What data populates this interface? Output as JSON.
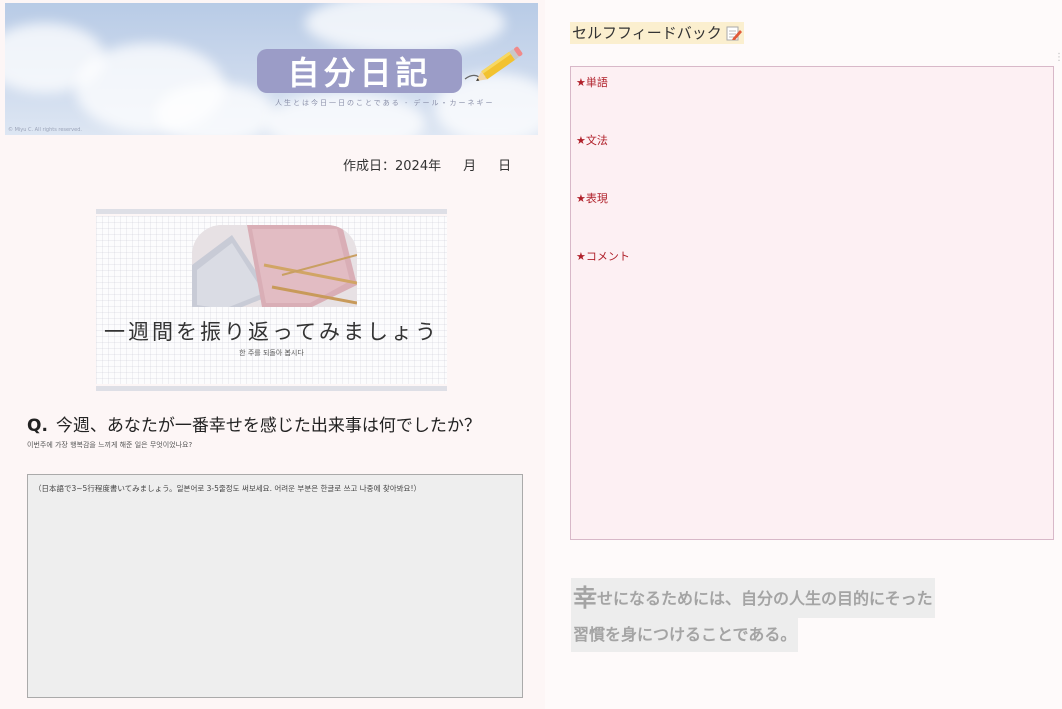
{
  "banner": {
    "title": "自分日記",
    "subtitle": "人生とは今日一日のことである - デール・カーネギー",
    "copyright": "© Miyu C. All rights reserved."
  },
  "created": {
    "label": "作成日：2024年",
    "month": "月",
    "day": "日"
  },
  "review_card": {
    "title": "一週間を振り返ってみましょう",
    "subtitle": "한 주를 되돌아 봅시다"
  },
  "question": {
    "prefix": "Q.",
    "text": "今週、あなたが一番幸せを感じた出来事は何でしたか？",
    "translation": "이번주에 가장 행복감을 느끼게 해준 일은 무엇이었나요?"
  },
  "answer": {
    "hint": "（日本語で3~5行程度書いてみましょう。일본어로 3-5줄정도 써보세요. 어려운 부분은 한글로 쓰고 나중에 찾아봐요!）"
  },
  "feedback": {
    "title": "セルフフィードバック",
    "items": [
      "★単語",
      "★文法",
      "★表現",
      "★コメント"
    ]
  },
  "quote": {
    "first_char": "幸",
    "line1_rest": "せになるためには、自分の人生の目的にそった",
    "line2": "習慣を身につけることである。"
  },
  "colors": {
    "banner_title_bg": "#9b9cc7",
    "feedback_bg": "#fdf0f3",
    "feedback_text": "#b0202a",
    "feedback_title_highlight": "#fbefcf"
  }
}
